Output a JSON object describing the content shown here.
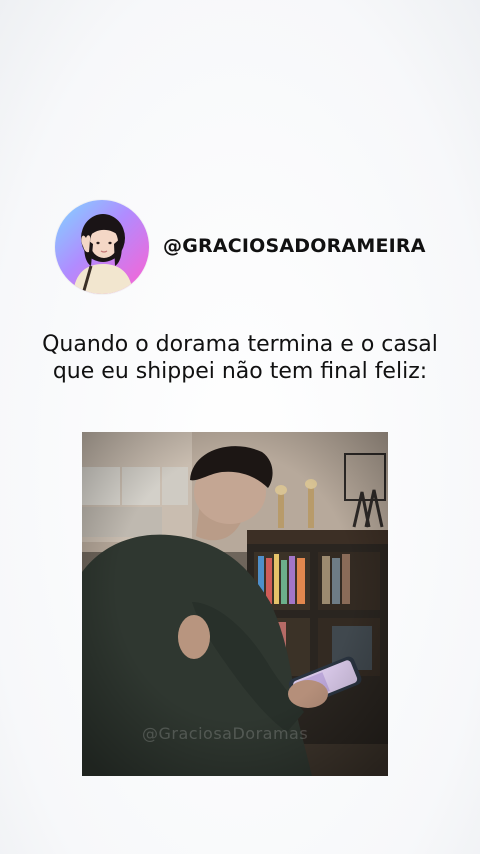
{
  "profile": {
    "handle": "@GRACIOSADORAMEIRA",
    "avatar_icon": "profile-avatar"
  },
  "post": {
    "caption": "Quando o dorama termina e o casal que eu shippei não tem final feliz:"
  },
  "media": {
    "watermark": "@GraciosaDoramas"
  },
  "colors": {
    "avatar_gradient": [
      "#7fd7ff",
      "#b08cff",
      "#ff5fd0"
    ],
    "text": "#111111",
    "background": "#ffffff"
  }
}
